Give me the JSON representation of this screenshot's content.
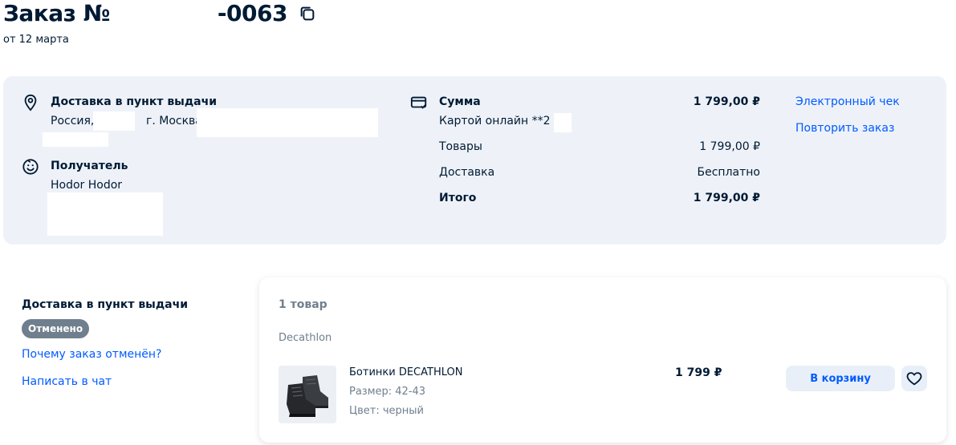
{
  "header": {
    "title_prefix": "Заказ №",
    "title_suffix": "-0063",
    "date": "от 12 марта"
  },
  "delivery": {
    "title": "Доставка в пункт выдачи",
    "country": "Россия,",
    "city": "г. Москва,"
  },
  "recipient": {
    "title": "Получатель",
    "name": "Hodor Hodor"
  },
  "payment": {
    "title": "Сумма",
    "total_top": "1 799,00 ₽",
    "method": "Картой онлайн **2",
    "goods_label": "Товары",
    "goods_value": "1 799,00 ₽",
    "shipping_label": "Доставка",
    "shipping_value": "Бесплатно",
    "total_label": "Итого",
    "total_value": "1 799,00 ₽"
  },
  "actions": {
    "receipt": "Электронный чек",
    "repeat": "Повторить заказ"
  },
  "shipment": {
    "title": "Доставка в пункт выдачи",
    "status": "Отменено",
    "why_cancelled": "Почему заказ отменён?",
    "chat": "Написать в чат"
  },
  "card": {
    "count": "1 товар",
    "seller": "Decathlon",
    "product": {
      "name": "Ботинки DECATHLON",
      "size": "Размер: 42-43",
      "color": "Цвет: черный",
      "price": "1 799 ₽",
      "add_to_cart": "В корзину"
    }
  },
  "colors": {
    "accent": "#005bff",
    "panel": "#eef2f8",
    "badge": "#707f8d",
    "text": "#001a34"
  }
}
